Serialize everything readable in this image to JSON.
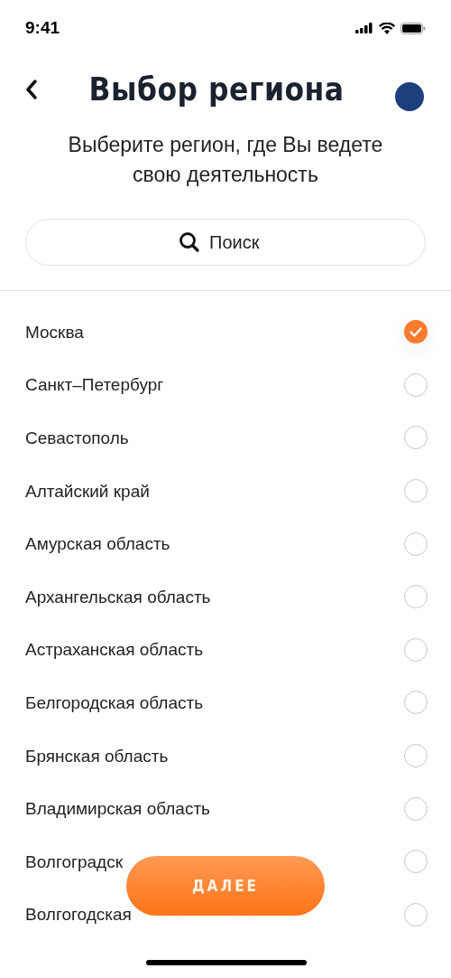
{
  "status_bar": {
    "time": "9:41"
  },
  "header": {
    "title": "Выбор региона",
    "subtitle": "Выберите регион, где Вы ведете свою деятельность"
  },
  "search": {
    "placeholder": "Поиск"
  },
  "regions": [
    {
      "name": "Москва",
      "selected": true
    },
    {
      "name": "Санкт–Петербург",
      "selected": false
    },
    {
      "name": "Севастополь",
      "selected": false
    },
    {
      "name": "Алтайский край",
      "selected": false
    },
    {
      "name": "Амурская область",
      "selected": false
    },
    {
      "name": "Архангельская область",
      "selected": false
    },
    {
      "name": "Астраханская область",
      "selected": false
    },
    {
      "name": "Белгородская область",
      "selected": false
    },
    {
      "name": "Брянская область",
      "selected": false
    },
    {
      "name": "Владимирская область",
      "selected": false
    },
    {
      "name": "Волгоградск",
      "selected": false
    },
    {
      "name": "Волгогодская",
      "selected": false
    }
  ],
  "next_button": {
    "label": "ДАЛЕЕ"
  }
}
